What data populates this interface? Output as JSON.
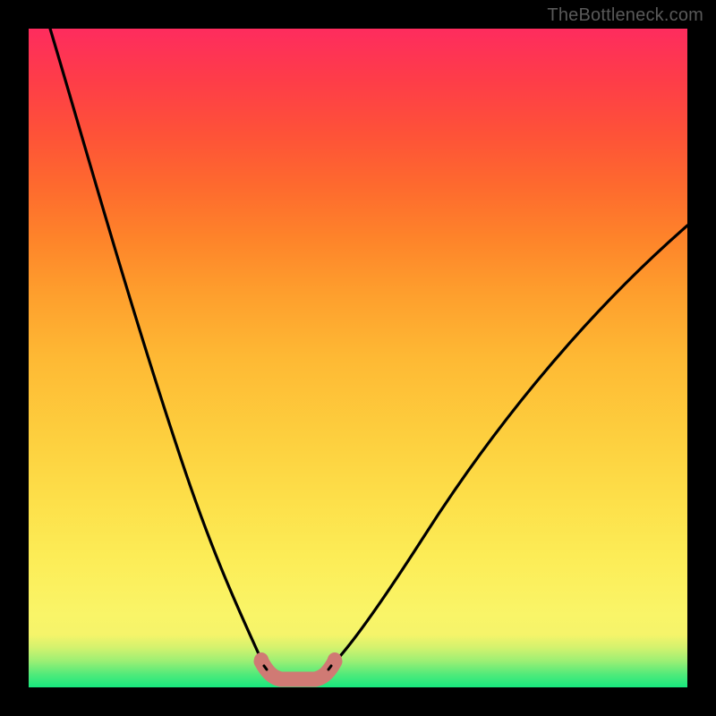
{
  "watermark": "TheBottleneck.com",
  "chart_data": {
    "type": "line",
    "title": "",
    "xlabel": "",
    "ylabel": "",
    "xlim": [
      0,
      100
    ],
    "ylim": [
      0,
      100
    ],
    "grid": false,
    "legend": false,
    "series": [
      {
        "name": "left-descending-curve",
        "x": [
          3,
          6,
          9,
          12,
          15,
          18,
          21,
          24,
          27,
          30,
          33,
          34.5,
          36
        ],
        "y": [
          100,
          88,
          76,
          65,
          55,
          46,
          38,
          30,
          23,
          16,
          10,
          6,
          3
        ]
      },
      {
        "name": "right-ascending-curve",
        "x": [
          46,
          49,
          53,
          58,
          64,
          71,
          79,
          88,
          100
        ],
        "y": [
          3,
          7,
          13,
          20,
          28,
          37,
          47,
          57,
          70
        ]
      },
      {
        "name": "valley-floor-highlight",
        "x": [
          36,
          37,
          38,
          39.5,
          41,
          42.5,
          44,
          45,
          46
        ],
        "y": [
          3,
          1.8,
          1.2,
          1,
          1,
          1.2,
          1.8,
          2.3,
          3
        ]
      }
    ],
    "highlight_color": "#d07a74",
    "curve_color": "#000000"
  }
}
